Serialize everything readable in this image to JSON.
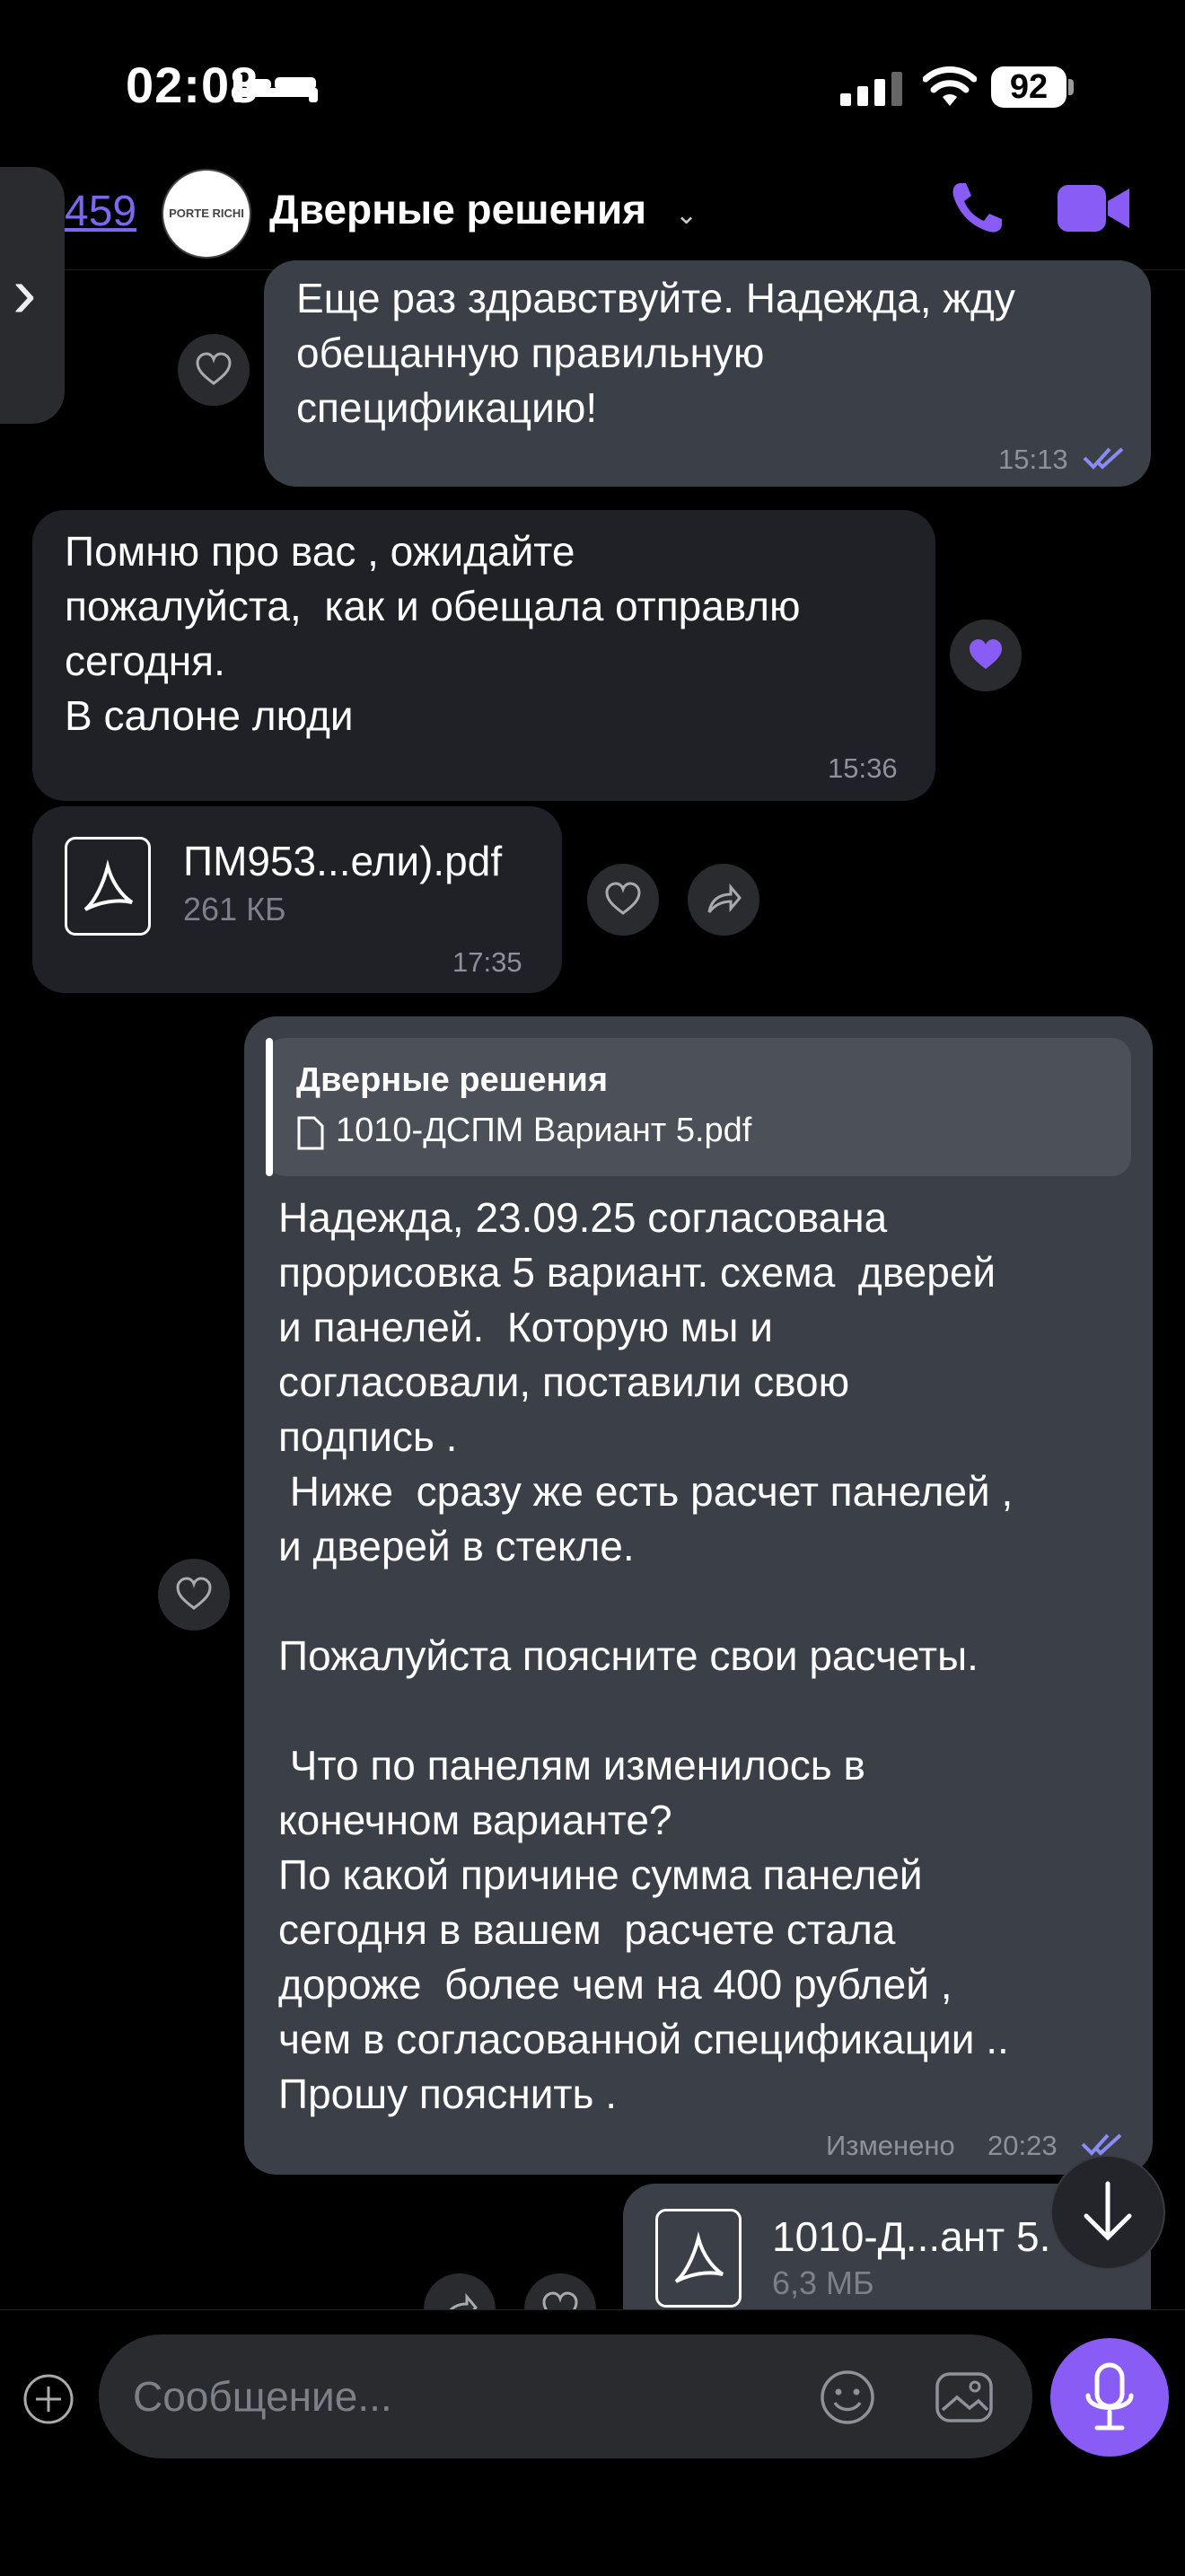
{
  "status": {
    "time": "02:08",
    "battery": "92"
  },
  "header": {
    "back_count": "459",
    "avatar_text": "PORTE RICHI",
    "title": "Дверные решения"
  },
  "messages": {
    "m1": {
      "text": "Еще раз здравствуйте. Надежда, жду\nобещанную правильную\nспецификацию!",
      "time": "15:13"
    },
    "m2": {
      "text": "Помню про вас , ожидайте\nпожалуйста,  как и обещала отправлю\nсегодня.\nВ салоне люди",
      "time": "15:36"
    },
    "m3": {
      "file_name": "ПМ953...ели).pdf",
      "file_size": "261 КБ",
      "time": "17:35"
    },
    "m4": {
      "reply_author": "Дверные решения",
      "reply_file": "1010-ДСПМ  Вариант 5.pdf",
      "text": "Надежда, 23.09.25 согласована\nпрорисовка 5 вариант. схема  дверей\nи панелей.  Которую мы и\nсогласовали, поставили свою\nподпись .\n Ниже  сразу же есть расчет панелей ,\nи дверей в стекле.\n\nПожалуйста поясните свои расчеты.\n\n Что по панелям изменилось в\nконечном варианте?\nПо какой причине сумма панелей\nсегодня в вашем  расчете стала\nдороже  более чем на 400 рублей ,\nчем в согласованной спецификации ..\nПрошу пояснить .",
      "edited": "Изменено",
      "time": "20:23"
    },
    "m5": {
      "file_name": "1010-Д...ант 5.",
      "file_size": "6,3 МБ"
    }
  },
  "input": {
    "placeholder": "Сообщение..."
  },
  "colors": {
    "accent": "#8a5cf6",
    "outgoing_bubble": "#3b3f47",
    "incoming_bubble": "#1f2126"
  }
}
